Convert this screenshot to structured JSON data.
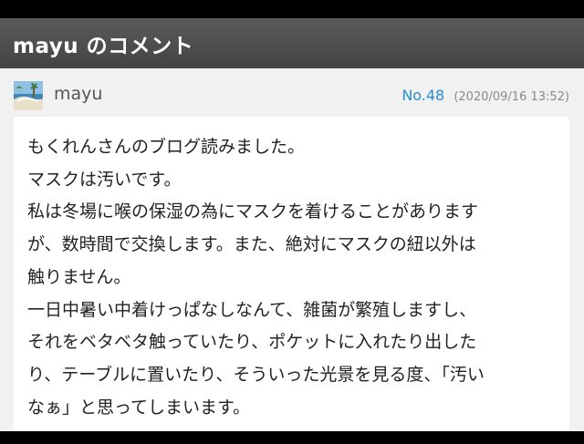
{
  "header": {
    "title": "mayu のコメント"
  },
  "comment": {
    "author": "mayu",
    "number": "No.48",
    "date": "(2020/09/16 13:52)",
    "avatar_icon": "beach-landscape-avatar-icon",
    "lines": [
      "もくれんさんのブログ読みました。",
      "マスクは汚いです。",
      "私は冬場に喉の保湿の為にマスクを着けることがあります",
      "が、数時間で交換します。また、絶対にマスクの紐以外は",
      "触りません。",
      "一日中暑い中着けっぱなしなんて、雑菌が繁殖しますし、",
      "それをベタベタ触っていたり、ポケットに入れたり出した",
      "り、テーブルに置いたり、そういった光景を見る度、「汚い",
      "なぁ」と思ってしまいます。"
    ]
  },
  "colors": {
    "header_bg": "#4d4d4d",
    "page_bg": "#f1f1f1",
    "comment_number": "#2a8fd0",
    "date_text": "#8a8a8a"
  }
}
